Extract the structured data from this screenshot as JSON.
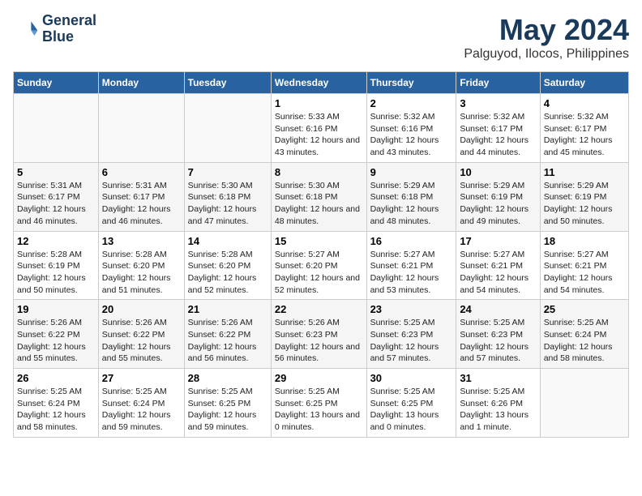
{
  "logo": {
    "line1": "General",
    "line2": "Blue"
  },
  "title": "May 2024",
  "location": "Palguyod, Ilocos, Philippines",
  "days_header": [
    "Sunday",
    "Monday",
    "Tuesday",
    "Wednesday",
    "Thursday",
    "Friday",
    "Saturday"
  ],
  "weeks": [
    [
      {
        "day": "",
        "sunrise": "",
        "sunset": "",
        "daylight": ""
      },
      {
        "day": "",
        "sunrise": "",
        "sunset": "",
        "daylight": ""
      },
      {
        "day": "",
        "sunrise": "",
        "sunset": "",
        "daylight": ""
      },
      {
        "day": "1",
        "sunrise": "Sunrise: 5:33 AM",
        "sunset": "Sunset: 6:16 PM",
        "daylight": "Daylight: 12 hours and 43 minutes."
      },
      {
        "day": "2",
        "sunrise": "Sunrise: 5:32 AM",
        "sunset": "Sunset: 6:16 PM",
        "daylight": "Daylight: 12 hours and 43 minutes."
      },
      {
        "day": "3",
        "sunrise": "Sunrise: 5:32 AM",
        "sunset": "Sunset: 6:17 PM",
        "daylight": "Daylight: 12 hours and 44 minutes."
      },
      {
        "day": "4",
        "sunrise": "Sunrise: 5:32 AM",
        "sunset": "Sunset: 6:17 PM",
        "daylight": "Daylight: 12 hours and 45 minutes."
      }
    ],
    [
      {
        "day": "5",
        "sunrise": "Sunrise: 5:31 AM",
        "sunset": "Sunset: 6:17 PM",
        "daylight": "Daylight: 12 hours and 46 minutes."
      },
      {
        "day": "6",
        "sunrise": "Sunrise: 5:31 AM",
        "sunset": "Sunset: 6:17 PM",
        "daylight": "Daylight: 12 hours and 46 minutes."
      },
      {
        "day": "7",
        "sunrise": "Sunrise: 5:30 AM",
        "sunset": "Sunset: 6:18 PM",
        "daylight": "Daylight: 12 hours and 47 minutes."
      },
      {
        "day": "8",
        "sunrise": "Sunrise: 5:30 AM",
        "sunset": "Sunset: 6:18 PM",
        "daylight": "Daylight: 12 hours and 48 minutes."
      },
      {
        "day": "9",
        "sunrise": "Sunrise: 5:29 AM",
        "sunset": "Sunset: 6:18 PM",
        "daylight": "Daylight: 12 hours and 48 minutes."
      },
      {
        "day": "10",
        "sunrise": "Sunrise: 5:29 AM",
        "sunset": "Sunset: 6:19 PM",
        "daylight": "Daylight: 12 hours and 49 minutes."
      },
      {
        "day": "11",
        "sunrise": "Sunrise: 5:29 AM",
        "sunset": "Sunset: 6:19 PM",
        "daylight": "Daylight: 12 hours and 50 minutes."
      }
    ],
    [
      {
        "day": "12",
        "sunrise": "Sunrise: 5:28 AM",
        "sunset": "Sunset: 6:19 PM",
        "daylight": "Daylight: 12 hours and 50 minutes."
      },
      {
        "day": "13",
        "sunrise": "Sunrise: 5:28 AM",
        "sunset": "Sunset: 6:20 PM",
        "daylight": "Daylight: 12 hours and 51 minutes."
      },
      {
        "day": "14",
        "sunrise": "Sunrise: 5:28 AM",
        "sunset": "Sunset: 6:20 PM",
        "daylight": "Daylight: 12 hours and 52 minutes."
      },
      {
        "day": "15",
        "sunrise": "Sunrise: 5:27 AM",
        "sunset": "Sunset: 6:20 PM",
        "daylight": "Daylight: 12 hours and 52 minutes."
      },
      {
        "day": "16",
        "sunrise": "Sunrise: 5:27 AM",
        "sunset": "Sunset: 6:21 PM",
        "daylight": "Daylight: 12 hours and 53 minutes."
      },
      {
        "day": "17",
        "sunrise": "Sunrise: 5:27 AM",
        "sunset": "Sunset: 6:21 PM",
        "daylight": "Daylight: 12 hours and 54 minutes."
      },
      {
        "day": "18",
        "sunrise": "Sunrise: 5:27 AM",
        "sunset": "Sunset: 6:21 PM",
        "daylight": "Daylight: 12 hours and 54 minutes."
      }
    ],
    [
      {
        "day": "19",
        "sunrise": "Sunrise: 5:26 AM",
        "sunset": "Sunset: 6:22 PM",
        "daylight": "Daylight: 12 hours and 55 minutes."
      },
      {
        "day": "20",
        "sunrise": "Sunrise: 5:26 AM",
        "sunset": "Sunset: 6:22 PM",
        "daylight": "Daylight: 12 hours and 55 minutes."
      },
      {
        "day": "21",
        "sunrise": "Sunrise: 5:26 AM",
        "sunset": "Sunset: 6:22 PM",
        "daylight": "Daylight: 12 hours and 56 minutes."
      },
      {
        "day": "22",
        "sunrise": "Sunrise: 5:26 AM",
        "sunset": "Sunset: 6:23 PM",
        "daylight": "Daylight: 12 hours and 56 minutes."
      },
      {
        "day": "23",
        "sunrise": "Sunrise: 5:25 AM",
        "sunset": "Sunset: 6:23 PM",
        "daylight": "Daylight: 12 hours and 57 minutes."
      },
      {
        "day": "24",
        "sunrise": "Sunrise: 5:25 AM",
        "sunset": "Sunset: 6:23 PM",
        "daylight": "Daylight: 12 hours and 57 minutes."
      },
      {
        "day": "25",
        "sunrise": "Sunrise: 5:25 AM",
        "sunset": "Sunset: 6:24 PM",
        "daylight": "Daylight: 12 hours and 58 minutes."
      }
    ],
    [
      {
        "day": "26",
        "sunrise": "Sunrise: 5:25 AM",
        "sunset": "Sunset: 6:24 PM",
        "daylight": "Daylight: 12 hours and 58 minutes."
      },
      {
        "day": "27",
        "sunrise": "Sunrise: 5:25 AM",
        "sunset": "Sunset: 6:24 PM",
        "daylight": "Daylight: 12 hours and 59 minutes."
      },
      {
        "day": "28",
        "sunrise": "Sunrise: 5:25 AM",
        "sunset": "Sunset: 6:25 PM",
        "daylight": "Daylight: 12 hours and 59 minutes."
      },
      {
        "day": "29",
        "sunrise": "Sunrise: 5:25 AM",
        "sunset": "Sunset: 6:25 PM",
        "daylight": "Daylight: 13 hours and 0 minutes."
      },
      {
        "day": "30",
        "sunrise": "Sunrise: 5:25 AM",
        "sunset": "Sunset: 6:25 PM",
        "daylight": "Daylight: 13 hours and 0 minutes."
      },
      {
        "day": "31",
        "sunrise": "Sunrise: 5:25 AM",
        "sunset": "Sunset: 6:26 PM",
        "daylight": "Daylight: 13 hours and 1 minute."
      },
      {
        "day": "",
        "sunrise": "",
        "sunset": "",
        "daylight": ""
      }
    ]
  ]
}
